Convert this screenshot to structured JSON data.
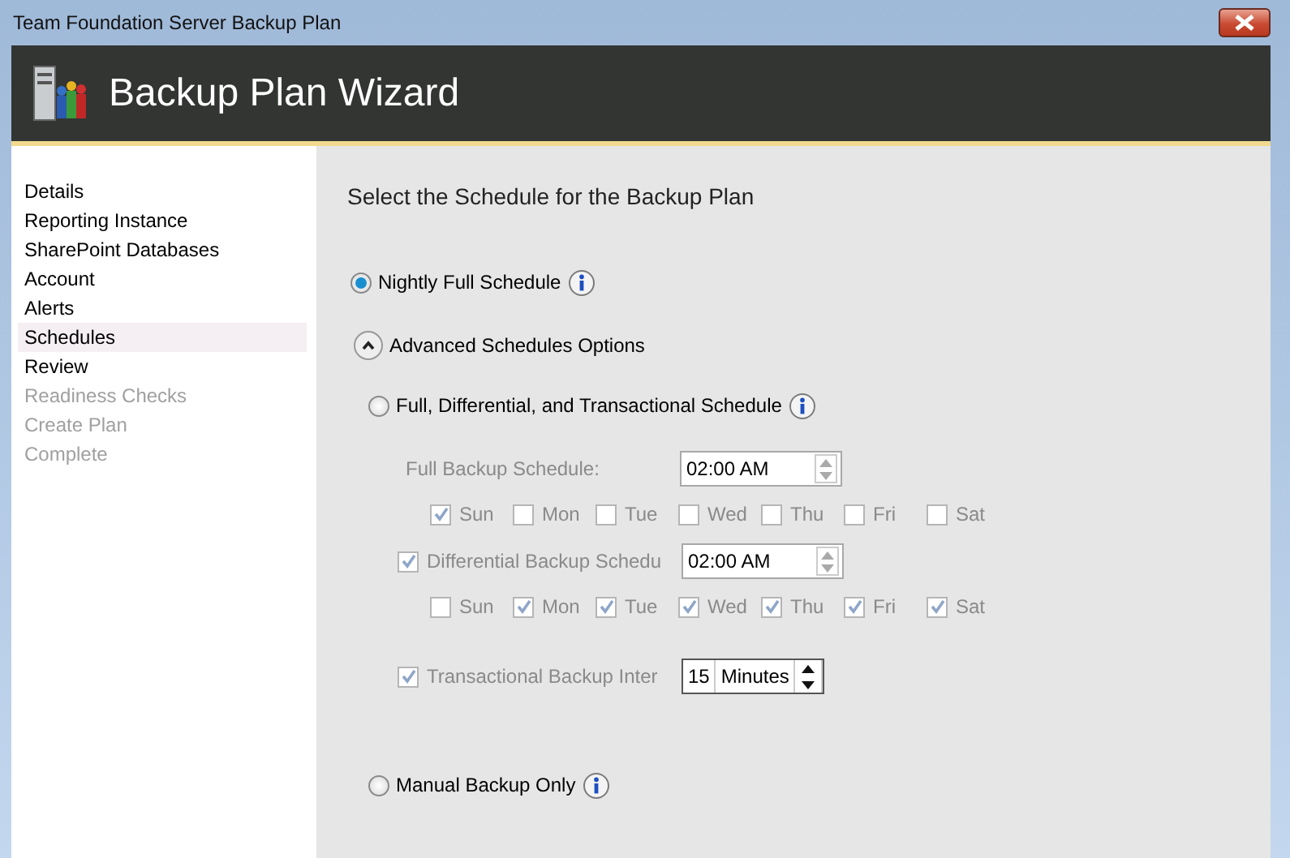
{
  "window": {
    "title": "Team Foundation Server Backup Plan"
  },
  "header": {
    "title": "Backup Plan Wizard"
  },
  "sidebar": {
    "items": [
      {
        "label": "Details",
        "selected": false,
        "disabled": false
      },
      {
        "label": "Reporting Instance",
        "selected": false,
        "disabled": false
      },
      {
        "label": "SharePoint Databases",
        "selected": false,
        "disabled": false
      },
      {
        "label": "Account",
        "selected": false,
        "disabled": false
      },
      {
        "label": "Alerts",
        "selected": false,
        "disabled": false
      },
      {
        "label": "Schedules",
        "selected": true,
        "disabled": false
      },
      {
        "label": "Review",
        "selected": false,
        "disabled": false
      },
      {
        "label": "Readiness Checks",
        "selected": false,
        "disabled": true
      },
      {
        "label": "Create Plan",
        "selected": false,
        "disabled": true
      },
      {
        "label": "Complete",
        "selected": false,
        "disabled": true
      }
    ]
  },
  "page": {
    "heading": "Select the Schedule for the Backup Plan",
    "nightly": {
      "label": "Nightly Full Schedule",
      "selected": true
    },
    "advanced": {
      "label": "Advanced Schedules Options",
      "expanded": true
    },
    "custom": {
      "label": "Full, Differential, and Transactional Schedule",
      "selected": false,
      "schedules": [
        {
          "kind": "fixed",
          "label": "Full Backup Schedule:",
          "time": "02:00 AM",
          "days": [
            {
              "label": "Sun",
              "checked": true
            },
            {
              "label": "Mon",
              "checked": false
            },
            {
              "label": "Tue",
              "checked": false
            },
            {
              "label": "Wed",
              "checked": false
            },
            {
              "label": "Thu",
              "checked": false
            },
            {
              "label": "Fri",
              "checked": false
            },
            {
              "label": "Sat",
              "checked": false
            }
          ]
        },
        {
          "kind": "optional",
          "checked": true,
          "label": "Differential Backup Schedu",
          "time": "02:00 AM",
          "days": [
            {
              "label": "Sun",
              "checked": false
            },
            {
              "label": "Mon",
              "checked": true
            },
            {
              "label": "Tue",
              "checked": true
            },
            {
              "label": "Wed",
              "checked": true
            },
            {
              "label": "Thu",
              "checked": true
            },
            {
              "label": "Fri",
              "checked": true
            },
            {
              "label": "Sat",
              "checked": true
            }
          ]
        },
        {
          "kind": "interval",
          "checked": true,
          "label": "Transactional Backup Inter",
          "value": "15",
          "unit": "Minutes"
        }
      ]
    },
    "manual": {
      "label": "Manual Backup Only",
      "selected": false
    }
  }
}
